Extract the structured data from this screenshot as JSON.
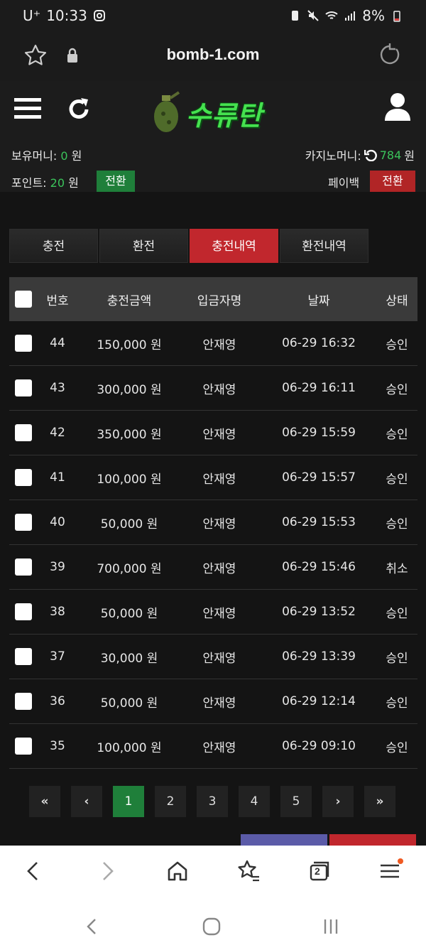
{
  "status": {
    "carrier": "U⁺",
    "time": "10:33",
    "battery": "8%"
  },
  "urlbar": {
    "url": "bomb-1.com"
  },
  "header": {
    "logo_text": "수류탄",
    "money_label": "보유머니:",
    "money_value": "0",
    "money_unit": "원",
    "casino_label": "카지노머니:",
    "casino_value": "784",
    "casino_unit": "원",
    "point_label": "포인트:",
    "point_value": "20",
    "point_unit": "원",
    "convert_label": "전환",
    "payback_label": "페이백",
    "payback_convert_label": "전환"
  },
  "tabs": [
    {
      "label": "충전"
    },
    {
      "label": "환전"
    },
    {
      "label": "충전내역"
    },
    {
      "label": "환전내역"
    }
  ],
  "active_tab": "충전내역",
  "table": {
    "headers": {
      "num": "번호",
      "amount": "충전금액",
      "name": "입금자명",
      "date": "날짜",
      "status": "상태"
    },
    "rows": [
      {
        "num": "44",
        "amount": "150,000 원",
        "name": "안재영",
        "date": "06-29 16:32",
        "status": "승인"
      },
      {
        "num": "43",
        "amount": "300,000 원",
        "name": "안재영",
        "date": "06-29 16:11",
        "status": "승인"
      },
      {
        "num": "42",
        "amount": "350,000 원",
        "name": "안재영",
        "date": "06-29 15:59",
        "status": "승인"
      },
      {
        "num": "41",
        "amount": "100,000 원",
        "name": "안재영",
        "date": "06-29 15:57",
        "status": "승인"
      },
      {
        "num": "40",
        "amount": "50,000 원",
        "name": "안재영",
        "date": "06-29 15:53",
        "status": "승인"
      },
      {
        "num": "39",
        "amount": "700,000 원",
        "name": "안재영",
        "date": "06-29 15:46",
        "status": "취소"
      },
      {
        "num": "38",
        "amount": "50,000 원",
        "name": "안재영",
        "date": "06-29 13:52",
        "status": "승인"
      },
      {
        "num": "37",
        "amount": "30,000 원",
        "name": "안재영",
        "date": "06-29 13:39",
        "status": "승인"
      },
      {
        "num": "36",
        "amount": "50,000 원",
        "name": "안재영",
        "date": "06-29 12:14",
        "status": "승인"
      },
      {
        "num": "35",
        "amount": "100,000 원",
        "name": "안재영",
        "date": "06-29 09:10",
        "status": "승인"
      }
    ]
  },
  "pagination": {
    "first": "«",
    "prev": "‹",
    "pages": [
      "1",
      "2",
      "3",
      "4",
      "5"
    ],
    "current": "1",
    "next": "›",
    "last": "»"
  },
  "browser": {
    "tab_count": "2"
  }
}
